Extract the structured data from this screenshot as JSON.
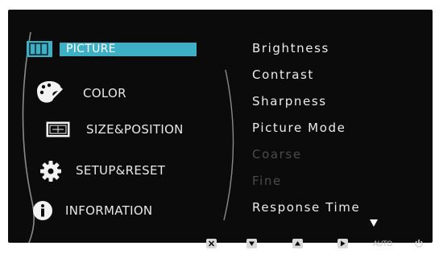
{
  "main_menu": {
    "items": [
      {
        "label": "PICTURE",
        "icon": "picture-icon",
        "selected": true
      },
      {
        "label": "COLOR",
        "icon": "palette-icon",
        "selected": false
      },
      {
        "label": "SIZE&POSITION",
        "icon": "size-position-icon",
        "selected": false
      },
      {
        "label": "SETUP&RESET",
        "icon": "gear-icon",
        "selected": false
      },
      {
        "label": "INFORMATION",
        "icon": "info-icon",
        "selected": false
      }
    ]
  },
  "submenu": {
    "items": [
      {
        "label": "Brightness",
        "enabled": true
      },
      {
        "label": "Contrast",
        "enabled": true
      },
      {
        "label": "Sharpness",
        "enabled": true
      },
      {
        "label": "Picture Mode",
        "enabled": true
      },
      {
        "label": "Coarse",
        "enabled": false
      },
      {
        "label": "Fine",
        "enabled": false
      },
      {
        "label": "Response Time",
        "enabled": true
      }
    ],
    "more_indicator": "down-arrow-icon"
  },
  "buttons": {
    "exit_icon": "close-icon",
    "down_icon": "down-arrow-icon",
    "up_icon": "up-arrow-icon",
    "enter_icon": "right-arrow-icon",
    "auto_label": "AUTO",
    "power_icon": "power-icon"
  },
  "colors": {
    "accent": "#3db0c6",
    "background": "#0b0b0b",
    "text": "#e8e8e8",
    "disabled_text": "#4b4b4b"
  }
}
